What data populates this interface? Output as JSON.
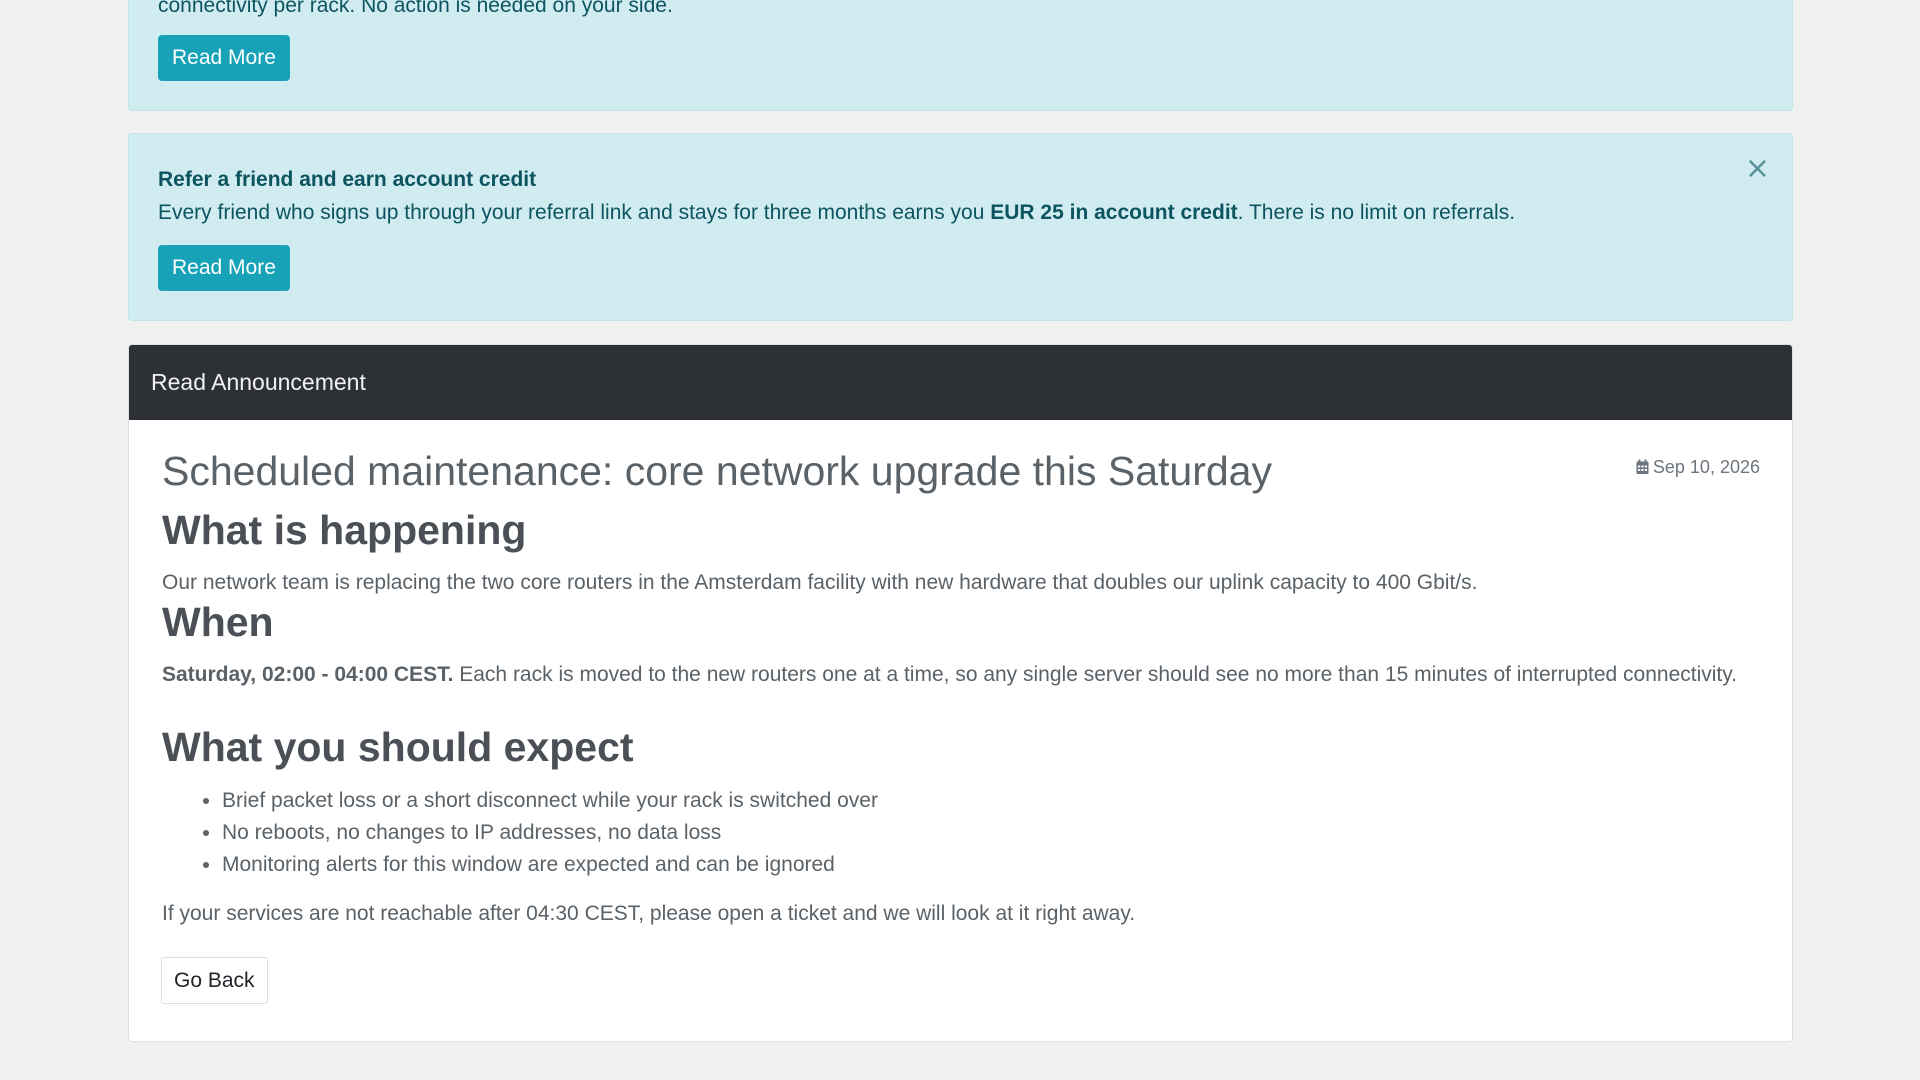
{
  "alert_top": {
    "text": "connectivity per rack. No action is needed on your side.",
    "button_label": "Read More"
  },
  "alert_referral": {
    "title": "Refer a friend and earn account credit",
    "text_before": "Every friend who signs up through your referral link and stays for three months earns you ",
    "text_bold": "EUR 25 in account credit",
    "text_after": ". There is no limit on referrals.",
    "button_label": "Read More",
    "close_glyph": "×"
  },
  "card": {
    "header": "Read Announcement",
    "title": "Scheduled maintenance: core network upgrade this Saturday",
    "date": "Sep 10, 2026",
    "date_icon": "calendar-icon",
    "sections": {
      "happening": {
        "heading": "What is happening",
        "text": "Our network team is replacing the two core routers in the Amsterdam facility with new hardware that doubles our uplink capacity to 400 Gbit/s."
      },
      "when": {
        "heading": "When",
        "text_bold": "Saturday, 02:00 - 04:00 CEST.",
        "text": " Each rack is moved to the new routers one at a time, so any single server should see no more than 15 minutes of interrupted connectivity."
      },
      "expect": {
        "heading": "What you should expect",
        "items": [
          "Brief packet loss or a short disconnect while your rack is switched over",
          "No reboots, no changes to IP addresses, no data loss",
          "Monitoring alerts for this window are expected and can be ignored"
        ]
      }
    },
    "footer_text": "If your services are not reachable after 04:30 CEST, please open a ticket and we will look at it right away.",
    "back_button": "Go Back"
  },
  "colors": {
    "alert_bg": "#d1ecf1",
    "alert_text": "#0c5460",
    "info_button": "#17a2b8",
    "card_header_bg": "#2d3135"
  }
}
